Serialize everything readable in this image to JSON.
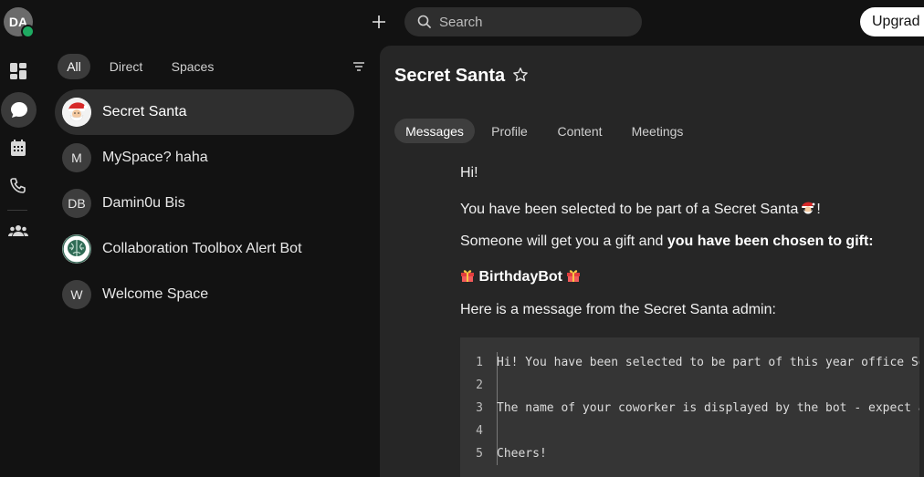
{
  "user": {
    "initials": "DA"
  },
  "header": {
    "search_placeholder": "Search",
    "upgrade_label": "Upgrad"
  },
  "filters": {
    "all": "All",
    "direct": "Direct",
    "spaces": "Spaces"
  },
  "spaces": [
    {
      "name": "Secret Santa",
      "avatar": "",
      "avatar_icon": "santa-avatar-icon"
    },
    {
      "name": "MySpace? haha",
      "avatar": "M"
    },
    {
      "name": "Damin0u Bis",
      "avatar": "DB"
    },
    {
      "name": "Collaboration Toolbox Alert Bot",
      "avatar": "",
      "avatar_icon": "brain-avatar-icon"
    },
    {
      "name": "Welcome Space",
      "avatar": "W"
    }
  ],
  "space_view": {
    "title": "Secret Santa",
    "tabs": [
      "Messages",
      "Profile",
      "Content",
      "Meetings"
    ],
    "messages": {
      "line1": "Hi!",
      "line2": "You have been selected to be part of a Secret Santa",
      "line2_end": "!",
      "line3_a": "Someone will get you a gift and ",
      "line3_b": "you have been chosen to gift:",
      "line4": "BirthdayBot",
      "line5": "Here is a message from the Secret Santa admin:"
    },
    "code_block": [
      {
        "n": "1",
        "text": "Hi! You have been selected to be part of this year office Se"
      },
      {
        "n": "2",
        "text": ""
      },
      {
        "n": "3",
        "text": "The name of your coworker is displayed by the bot - expect a"
      },
      {
        "n": "4",
        "text": ""
      },
      {
        "n": "5",
        "text": "Cheers!"
      }
    ]
  },
  "colors": {
    "status_online": "#1eaa61",
    "background": "#121212",
    "panel": "#262626"
  }
}
